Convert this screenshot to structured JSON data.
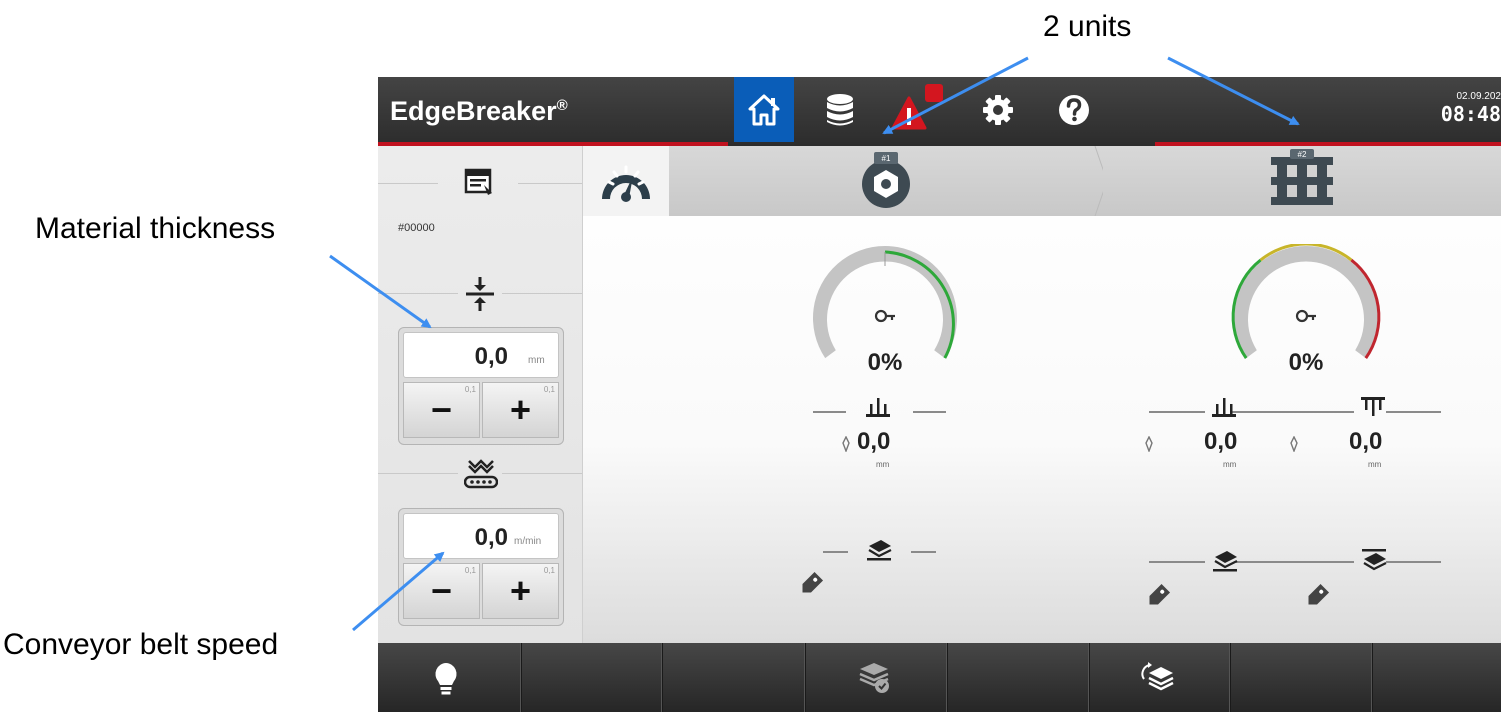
{
  "annotations": {
    "units": "2 units",
    "thickness": "Material thickness",
    "speed": "Conveyor belt speed"
  },
  "app": {
    "title": "EdgeBreaker",
    "trademark": "®",
    "date": "02.09.202",
    "time": "08:48"
  },
  "nav": {
    "items": [
      "home-icon",
      "database-icon",
      "alarm-icon",
      "settings-icon",
      "help-icon"
    ],
    "active": "home-icon"
  },
  "left_panel": {
    "recipe": "#00000",
    "thickness": {
      "value": "0,0",
      "unit": "mm",
      "step_minus": "0,1",
      "step_plus": "0,1"
    },
    "speed": {
      "value": "0,0",
      "unit": "m/min",
      "step_minus": "0,1",
      "step_plus": "0,1"
    },
    "minus_label": "−",
    "plus_label": "+"
  },
  "units": [
    {
      "tab_badge": "#1",
      "load_percent": "0%",
      "load_fraction": 0.0,
      "measurements": [
        {
          "value": "0,0",
          "unit": "mm"
        }
      ]
    },
    {
      "tab_badge": "#2",
      "load_percent": "0%",
      "load_fraction": 0.0,
      "measurements": [
        {
          "value": "0,0",
          "unit": "mm"
        },
        {
          "value": "0,0",
          "unit": "mm"
        }
      ]
    }
  ],
  "colors": {
    "accent_blue": "#0a5db8",
    "status_red": "#c1121f",
    "gauge_green": "#2ea83a",
    "gauge_yellow": "#c8b52a",
    "gauge_red": "#c0262f",
    "arrow_blue": "#3d8ef0"
  },
  "bottom_bar": {
    "items": [
      "lightbulb-icon",
      "sheet-check-icon",
      "sheet-swap-icon"
    ]
  }
}
